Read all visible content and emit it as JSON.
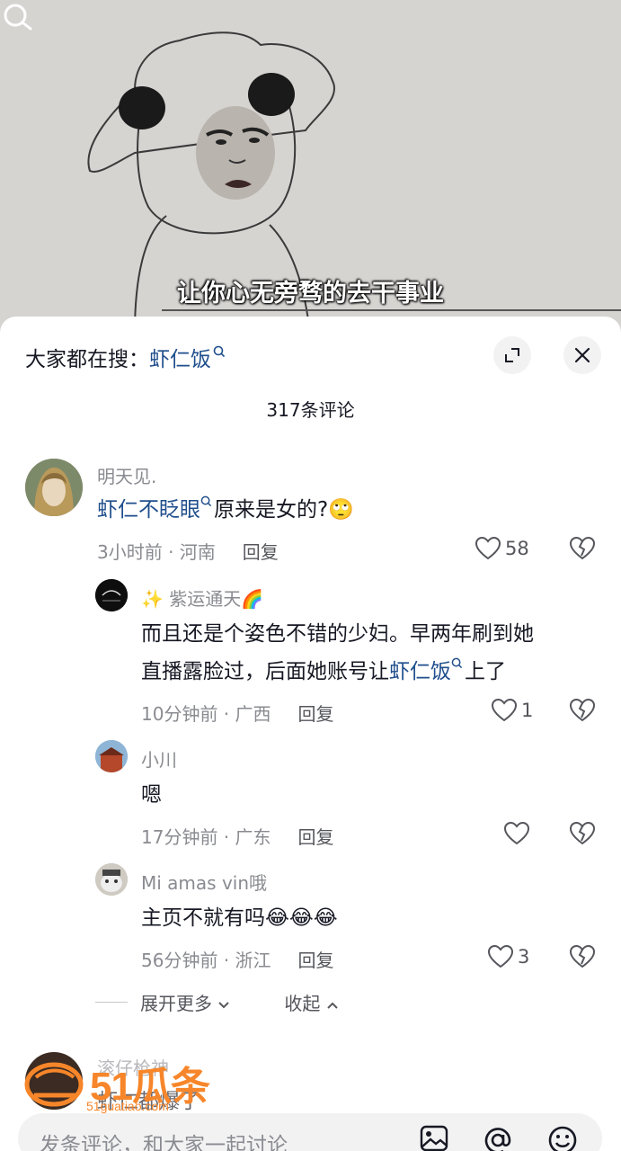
{
  "video": {
    "subtitle": "让你心无旁骛的去干事业"
  },
  "sheet": {
    "search_prefix": "大家都在搜：",
    "search_keyword": "虾仁饭",
    "comment_count": "317条评论"
  },
  "comments": [
    {
      "name": "明天见.",
      "keyword": "虾仁不眨眼",
      "text": "原来是女的?",
      "emoji": "🙄",
      "time_loc": "3小时前 · 河南",
      "reply": "回复",
      "likes": "58"
    },
    {
      "name": "✨ 紫运通天🌈",
      "text_line1": "而且还是个姿色不错的少妇。早两年刷到她",
      "text_line2_pre": "直播露脸过，后面她账号让",
      "keyword": "虾仁饭",
      "text_line2_post": "上了",
      "time_loc": "10分钟前 · 广西",
      "reply": "回复",
      "likes": "1"
    },
    {
      "name": "小川",
      "text": "嗯",
      "time_loc": "17分钟前 · 广东",
      "reply": "回复",
      "likes": ""
    },
    {
      "name": "Mi amas vin哦",
      "text": "主页不就有吗",
      "emoji": "😂😂😂",
      "time_loc": "56分钟前 · 浙江",
      "reply": "回复",
      "likes": "3"
    }
  ],
  "expand": {
    "more": "展开更多",
    "collapse": "收起"
  },
  "partial_comment": {
    "name": "滚仔枪神",
    "text": "虾仁都爆了"
  },
  "input": {
    "placeholder": "发条评论，和大家一起讨论"
  },
  "watermark": {
    "brand": "51瓜条",
    "url": "51guatiao.com"
  },
  "icons": {
    "search": "search-icon",
    "expand": "expand-icon",
    "close": "close-icon",
    "heart": "heart-icon",
    "dislike": "broken-heart-icon",
    "image": "image-icon",
    "mention": "at-icon",
    "emoji": "emoji-icon"
  },
  "colors": {
    "keyword": "#1f4e8c",
    "watermark": "#f7862a"
  }
}
